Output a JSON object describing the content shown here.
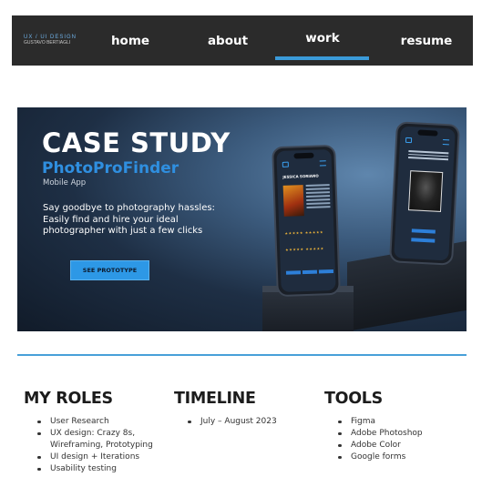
{
  "nav": {
    "logo_top": "UX / UI DESIGN",
    "logo_bottom": "GUSTAVO BERTIAGLI",
    "items": [
      {
        "label": "home"
      },
      {
        "label": "about"
      },
      {
        "label": "work"
      },
      {
        "label": "resume"
      }
    ],
    "active": "work",
    "accent_color": "#3a9ad9"
  },
  "hero": {
    "title": "CASE STUDY",
    "subtitle": "PhotoProFinder",
    "kind": "Mobile App",
    "tagline_lines": [
      "Say goodbye to photography hassles:",
      "Easily find and hire your ideal",
      "photographer with just a few clicks"
    ],
    "cta_label": "SEE PROTOTYPE",
    "phone_profile_name": "JESSICA SORIANO"
  },
  "sections": {
    "roles": {
      "heading": "MY ROLES",
      "items": [
        [
          "User Research"
        ],
        [
          "UX design: Crazy 8s,",
          "Wireframing, Prototyping"
        ],
        [
          "UI design + Iterations"
        ],
        [
          "Usability testing"
        ]
      ]
    },
    "timeline": {
      "heading": "TIMELINE",
      "items": [
        [
          "July – August 2023"
        ]
      ]
    },
    "tools": {
      "heading": "TOOLS",
      "items": [
        [
          "Figma"
        ],
        [
          "Adobe Photoshop"
        ],
        [
          "Adobe Color"
        ],
        [
          "Google forms"
        ]
      ]
    }
  },
  "icons": [
    "camera-icon",
    "menu-icon",
    "star-icon",
    "bullet-icon"
  ]
}
